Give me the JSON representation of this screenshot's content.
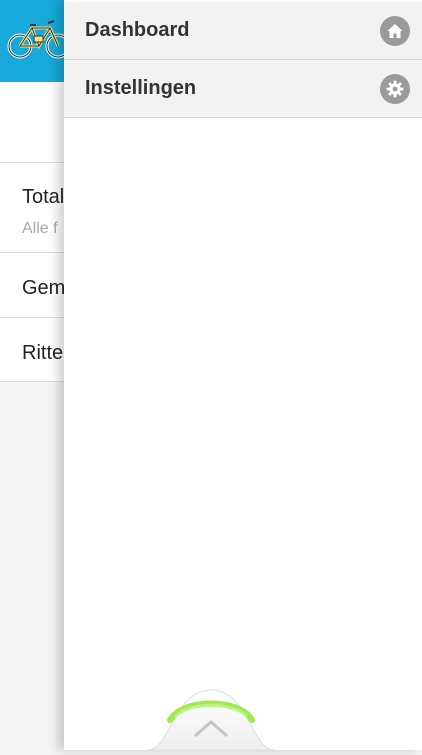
{
  "background_screen": {
    "rows": [
      {
        "title": "Total",
        "subtitle": "Alle f"
      },
      {
        "title": "Gem"
      },
      {
        "title": "Ritte"
      }
    ]
  },
  "drawer": {
    "items": [
      {
        "label": "Dashboard",
        "icon": "home-icon"
      },
      {
        "label": "Instellingen",
        "icon": "gear-icon"
      }
    ]
  },
  "colors": {
    "header_accent": "#17a9d9",
    "handle_glow": "#7fe31e",
    "menu_icon": "#9a9a9a"
  }
}
